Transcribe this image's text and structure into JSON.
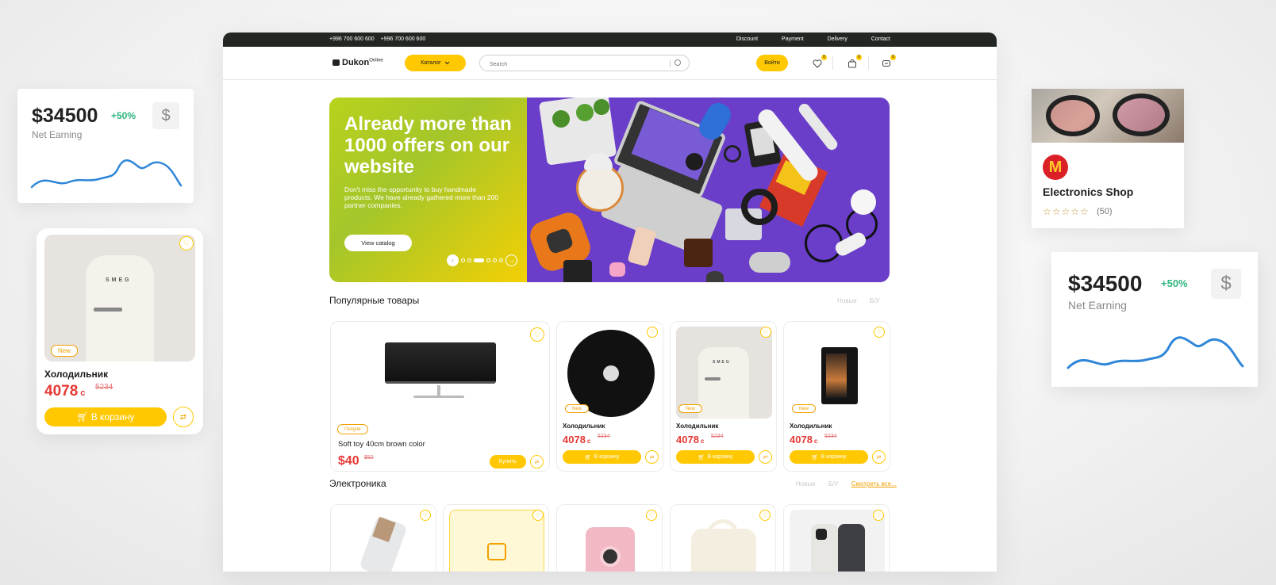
{
  "topbar": {
    "phones": [
      "+996 700 600 600",
      "+996 700 600 600"
    ],
    "links": [
      "Discount",
      "Payment",
      "Delivery",
      "Contact"
    ]
  },
  "header": {
    "logo": "Dukon",
    "logo_sup": "Online",
    "catalog_label": "Каталог",
    "search_placeholder": "Search",
    "login_label": "Войти",
    "badges": [
      "0",
      "0",
      "0"
    ]
  },
  "hero": {
    "title": "Already more than 1000 offers on our website",
    "subtitle": "Don't miss the opportunity to buy handmade products. We have already gathered more than 200 partner companies.",
    "button_label": "View catalog"
  },
  "popular": {
    "title": "Популярные товары",
    "filters": [
      "Новые",
      "Б/У"
    ],
    "wide_card": {
      "badge": "Популя",
      "name": "Soft toy 40cm brown color",
      "price": "$40",
      "old_price": "$52",
      "buy_label": "Купить"
    },
    "cards": [
      {
        "badge": "New",
        "name": "Холодильник",
        "price": "4078",
        "currency": "с",
        "old_price": "5234",
        "cart_label": "В корзину"
      },
      {
        "badge": "New",
        "name": "Холодильник",
        "price": "4078",
        "currency": "с",
        "old_price": "5234",
        "cart_label": "В корзину"
      },
      {
        "badge": "New",
        "name": "Холодильник",
        "price": "4078",
        "currency": "с",
        "old_price": "5234",
        "cart_label": "В корзину"
      }
    ]
  },
  "electronics": {
    "title": "Электроника",
    "filters": [
      "Новые",
      "Б/У"
    ],
    "see_all": "Смотреть все..."
  },
  "widget_earn_left": {
    "amount": "$34500",
    "percent": "+50%",
    "label": "Net Earning",
    "currency_icon": "$"
  },
  "widget_earn_right": {
    "amount": "$34500",
    "percent": "+50%",
    "label": "Net Earning",
    "currency_icon": "$"
  },
  "widget_product": {
    "badge": "New",
    "name": "Холодильник",
    "price": "4078",
    "currency": "с",
    "old_price": "5234",
    "cart_label": "В корзину"
  },
  "widget_shop": {
    "name": "Electronics Shop",
    "rating_count": "(50)",
    "stars": 0
  },
  "colors": {
    "accent": "#ffc800",
    "price": "#e53935",
    "positive": "#2eb67d",
    "topbar": "#222723"
  }
}
